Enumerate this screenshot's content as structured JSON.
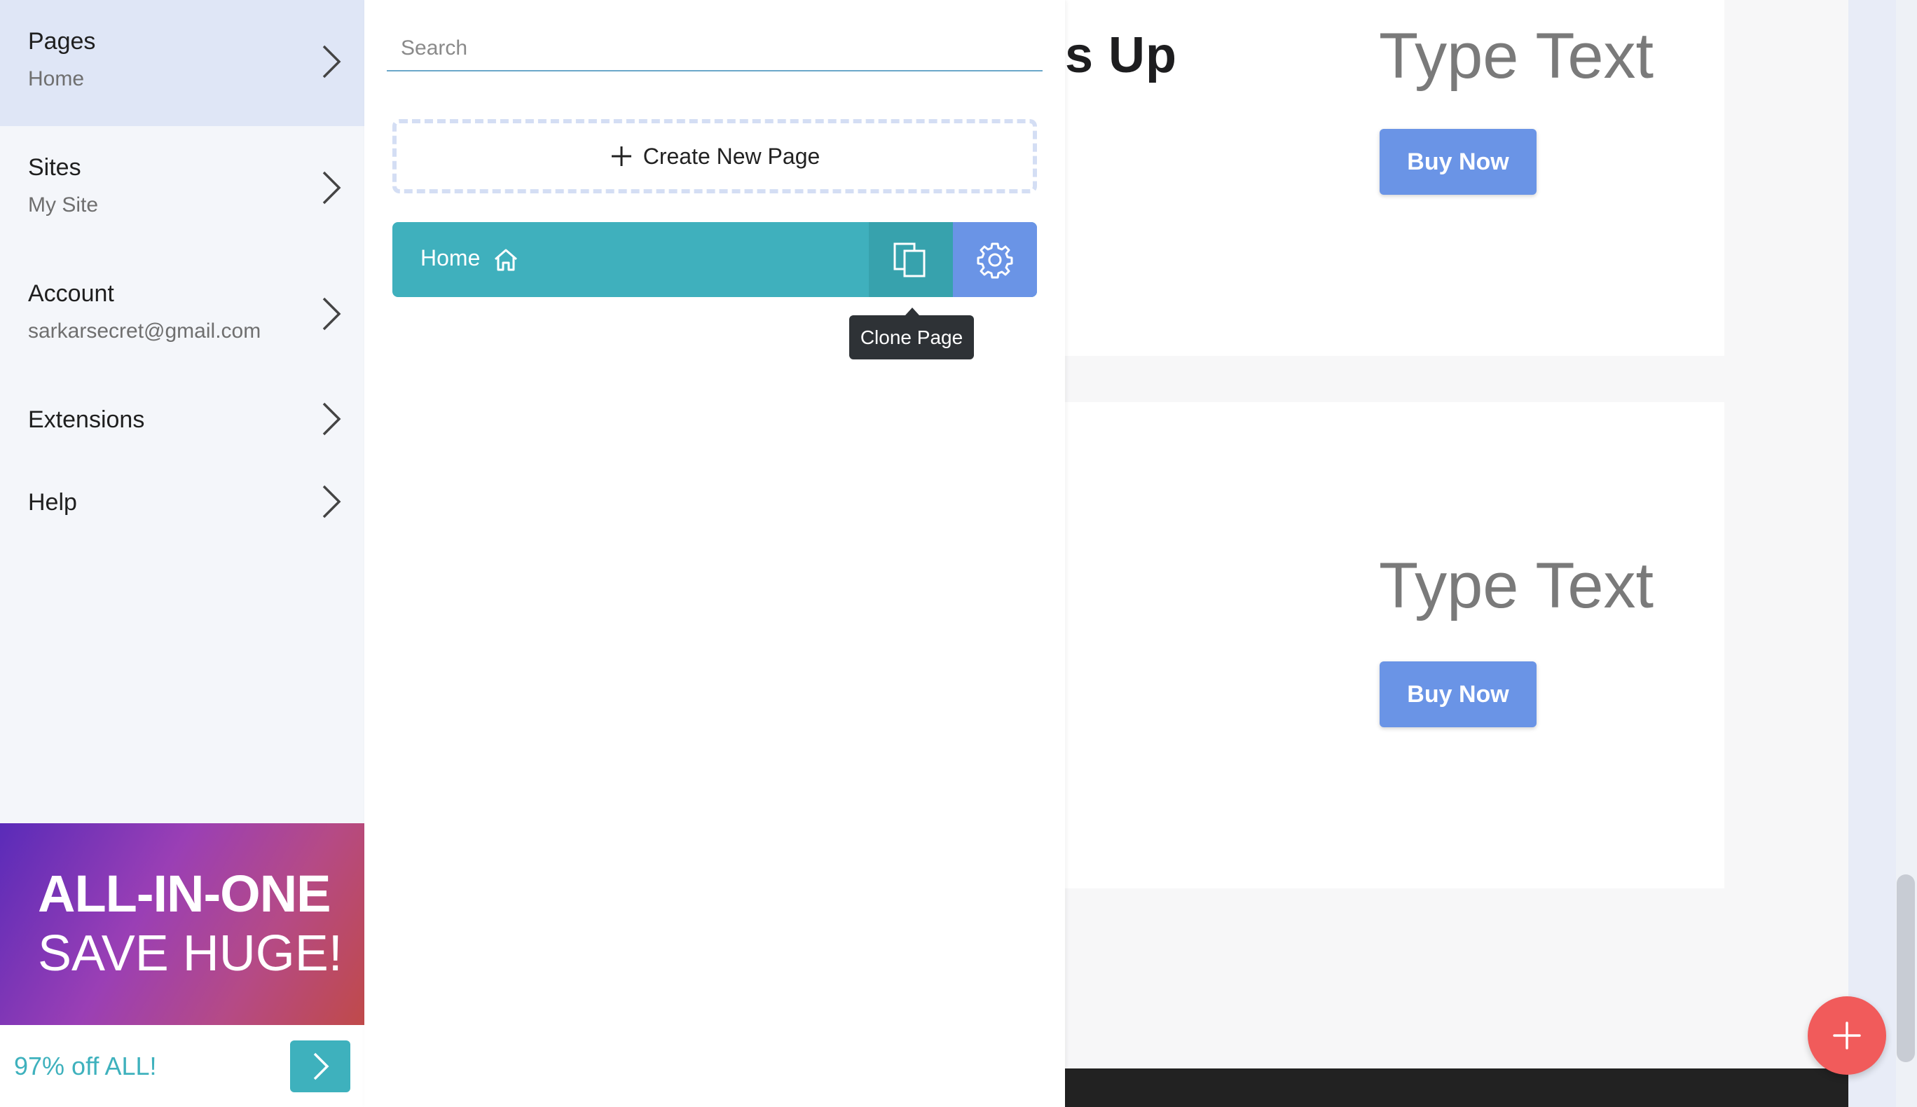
{
  "nav": {
    "items": [
      {
        "title": "Pages",
        "subtitle": "Home"
      },
      {
        "title": "Sites",
        "subtitle": "My Site"
      },
      {
        "title": "Account",
        "subtitle": "sarkarsecret@gmail.com"
      },
      {
        "title": "Extensions"
      },
      {
        "title": "Help"
      }
    ]
  },
  "promo": {
    "line1": "ALL-IN-ONE",
    "line2": "SAVE HUGE!",
    "offer": "97% off ALL!"
  },
  "pages_panel": {
    "search_placeholder": "Search",
    "create_label": "Create New Page",
    "pages": [
      {
        "name": "Home"
      }
    ],
    "tooltip": "Clone Page"
  },
  "canvas": {
    "heading_partial": "s Up",
    "blocks": [
      {
        "type_text": "Type Text",
        "button": "Buy Now"
      },
      {
        "type_text": "Type Text",
        "button": "Buy Now"
      }
    ]
  },
  "colors": {
    "accent_teal": "#3fb0bd",
    "accent_blue": "#6a94e6",
    "fab_red": "#f15b5b"
  }
}
